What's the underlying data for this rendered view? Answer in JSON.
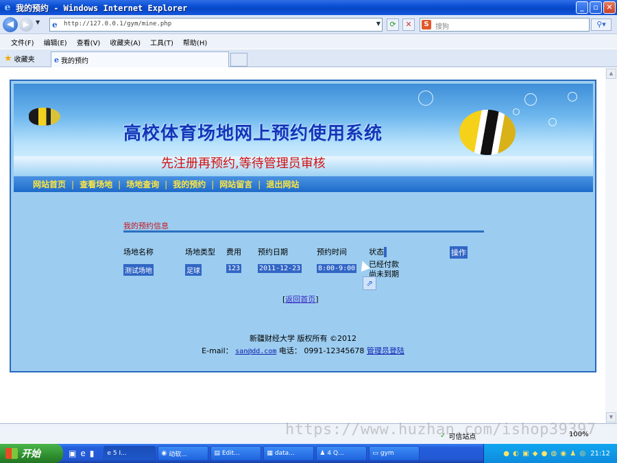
{
  "window": {
    "title": "我的预约 - Windows Internet Explorer",
    "ie_logo": "e"
  },
  "window_buttons": {
    "minimize": "_",
    "maximize": "▫",
    "close": "✕"
  },
  "navbar": {
    "url": "http://127.0.0.1/gym/mine.php",
    "search_placeholder": "搜狗",
    "search_logo": "S"
  },
  "menu": [
    "文件(F)",
    "编辑(E)",
    "查看(V)",
    "收藏夹(A)",
    "工具(T)",
    "帮助(H)"
  ],
  "favbar": {
    "favorites_label": "收藏夹",
    "tab_label": "我的预约"
  },
  "page": {
    "banner_title": "高校体育场地网上预约使用系统",
    "banner_subtitle": "先注册再预约,等待管理员审核",
    "nav": [
      "网站首页",
      "查看场地",
      "场地查询",
      "我的预约",
      "网站留言",
      "退出网站"
    ],
    "section_title": "我的预约信息",
    "table": {
      "headers": [
        "场地名称",
        "场地类型",
        "费用",
        "预约日期",
        "预约时间",
        "状态",
        "操作"
      ],
      "row": {
        "name": "测试场地",
        "type": "足球",
        "fee": "123",
        "date": "2011-12-23",
        "time": "8:00-9:00",
        "status_paid": "已经付款",
        "status_pending": "尚未到期"
      }
    },
    "back_link": "返回首页",
    "footer_line1": "新疆财经大学 版权所有 ©2012",
    "footer_email_label": "E-mail：",
    "footer_email": "san@dd.com",
    "footer_phone_label": "电话：",
    "footer_phone": "0991-12345678",
    "footer_admin": "管理员登陆"
  },
  "statusbar": {
    "watermark": "https://www.huzhan.com/ishop39397",
    "trusted": "可信站点",
    "zoom": "100%"
  },
  "taskbar": {
    "start": "开始",
    "tasks": [
      "5 I...",
      "动软...",
      "Edit...",
      "data...",
      "4 Q...",
      "gym"
    ],
    "clock": "21:12"
  }
}
